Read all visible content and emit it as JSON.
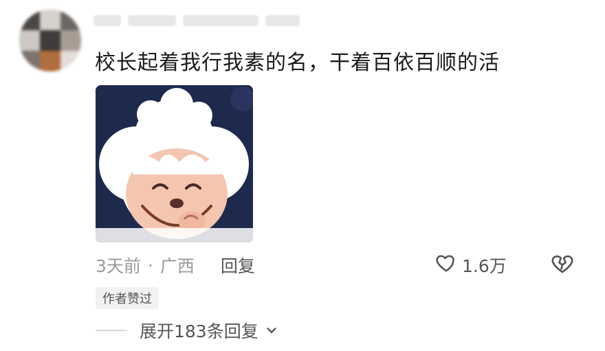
{
  "comment": {
    "text": "校长起着我行我素的名，干着百依百顺的活",
    "meta": {
      "time": "3天前",
      "separator": "·",
      "location": "广西",
      "reply_label": "回复"
    },
    "likes": {
      "count": "1.6万"
    },
    "badge": "作者赞过",
    "expand_label": "展开183条回复"
  },
  "icons": {
    "like": "heart-outline-icon",
    "dislike": "broken-heart-outline-icon",
    "expand": "chevron-down-icon"
  },
  "colors": {
    "text_primary": "#1b1b1b",
    "text_secondary": "#9a9a9a",
    "text_action": "#555555",
    "badge_bg": "#f1f1f1"
  }
}
